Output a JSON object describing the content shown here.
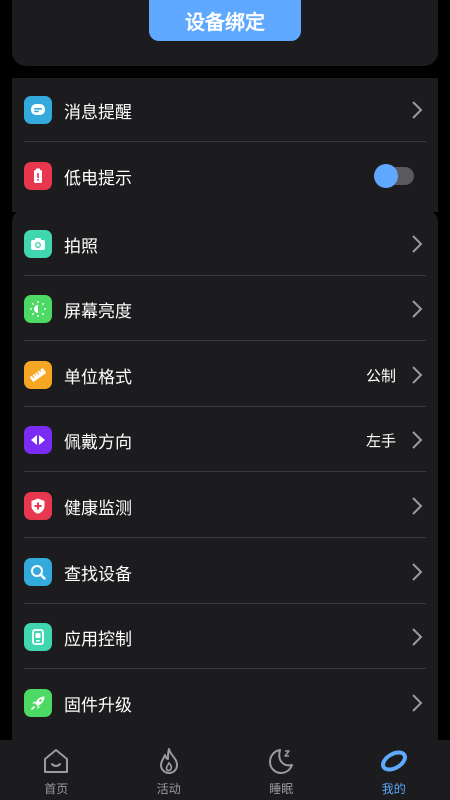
{
  "header": {
    "bind_button": "设备绑定"
  },
  "colors": {
    "accent": "#5fa8ff",
    "card": "#1c1c1e",
    "background": "#000000"
  },
  "settings_group1": [
    {
      "label": "消息提醒",
      "icon": "message-icon",
      "icon_color": "#34aadc",
      "control": "chevron"
    },
    {
      "label": "低电提示",
      "icon": "battery-icon",
      "icon_color": "#e8384f",
      "control": "toggle",
      "toggle_on": false
    }
  ],
  "settings_group2": [
    {
      "label": "拍照",
      "icon": "camera-icon",
      "icon_color": "#3fd6b0",
      "value": ""
    },
    {
      "label": "屏幕亮度",
      "icon": "brightness-icon",
      "icon_color": "#4cd964",
      "value": ""
    },
    {
      "label": "单位格式",
      "icon": "ruler-icon",
      "icon_color": "#f5a623",
      "value": "公制"
    },
    {
      "label": "佩戴方向",
      "icon": "orientation-icon",
      "icon_color": "#7a2cf2",
      "value": "左手"
    },
    {
      "label": "健康监测",
      "icon": "shield-cross-icon",
      "icon_color": "#e8384f",
      "value": ""
    },
    {
      "label": "查找设备",
      "icon": "search-device-icon",
      "icon_color": "#34aadc",
      "value": ""
    },
    {
      "label": "应用控制",
      "icon": "app-control-icon",
      "icon_color": "#3fd6b0",
      "value": ""
    },
    {
      "label": "固件升级",
      "icon": "rocket-icon",
      "icon_color": "#4cd964",
      "value": ""
    }
  ],
  "tabbar": [
    {
      "label": "首页",
      "icon": "home-icon",
      "active": false
    },
    {
      "label": "活动",
      "icon": "flame-icon",
      "active": false
    },
    {
      "label": "睡眠",
      "icon": "moon-icon",
      "active": false
    },
    {
      "label": "我的",
      "icon": "watch-ring-icon",
      "active": true
    }
  ]
}
